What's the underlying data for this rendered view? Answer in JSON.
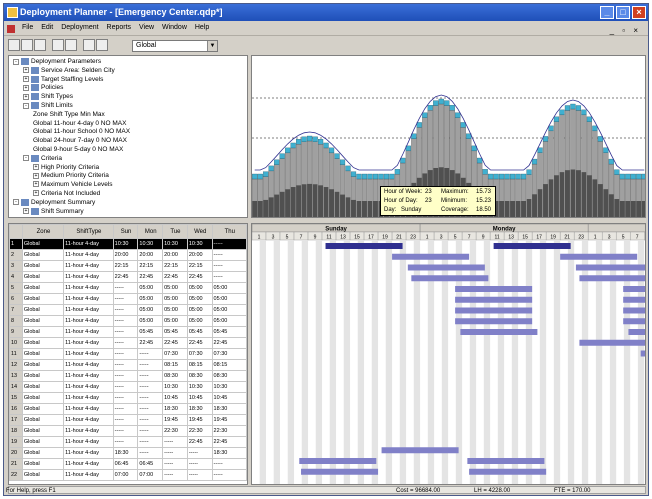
{
  "window": {
    "title": "Deployment Planner - [Emergency Center.qdp*]"
  },
  "menu": {
    "items": [
      "File",
      "Edit",
      "Deployment",
      "Reports",
      "View",
      "Window",
      "Help"
    ]
  },
  "toolbar": {
    "combo_value": "Global"
  },
  "tree": {
    "items": [
      {
        "label": "Deployment Parameters",
        "indent": 0,
        "box": "-"
      },
      {
        "label": "Service Area: Selden City",
        "indent": 1,
        "box": "+"
      },
      {
        "label": "Target Staffing Levels",
        "indent": 1,
        "box": "+"
      },
      {
        "label": "Policies",
        "indent": 1,
        "box": "+"
      },
      {
        "label": "Shift Types",
        "indent": 1,
        "box": "+"
      },
      {
        "label": "Shift Limits",
        "indent": 1,
        "box": "-"
      },
      {
        "label": "Zone  Shift Type       Min     Max",
        "indent": 2,
        "box": ""
      },
      {
        "label": "Global  11-hour 4-day   0        NO MAX",
        "indent": 2,
        "box": ""
      },
      {
        "label": "Global  11-hour School  0        NO MAX",
        "indent": 2,
        "box": ""
      },
      {
        "label": "Global  24-hour 7-day   0        NO MAX",
        "indent": 2,
        "box": ""
      },
      {
        "label": "Global  9-hour 5-day    0        NO MAX",
        "indent": 2,
        "box": ""
      },
      {
        "label": "Criteria",
        "indent": 1,
        "box": "-"
      },
      {
        "label": "High Priority Criteria",
        "indent": 2,
        "box": "+"
      },
      {
        "label": "Medium Priority Criteria",
        "indent": 2,
        "box": "+"
      },
      {
        "label": "Maximum Vehicle Levels",
        "indent": 2,
        "box": "+"
      },
      {
        "label": "Criteria Not Included",
        "indent": 2,
        "box": "+"
      },
      {
        "label": "Deployment Summary",
        "indent": 0,
        "box": "-"
      },
      {
        "label": "Shift Summary",
        "indent": 1,
        "box": "+"
      }
    ]
  },
  "tooltip": {
    "hour_of_week_label": "Hour of Week:",
    "hour_of_week": "23",
    "hour_of_day_label": "Hour of Day:",
    "hour_of_day": "23",
    "day_label": "Day:",
    "day": "Sunday",
    "maximum_label": "Maximum:",
    "maximum": "15.73",
    "minimum_label": "Minimum:",
    "minimum": "15.23",
    "coverage_label": "Coverage:",
    "coverage": "18.50"
  },
  "grid": {
    "columns": [
      "",
      "Zone",
      "ShiftType",
      "Sun",
      "Mon",
      "Tue",
      "Wed",
      "Thu"
    ],
    "rows": [
      [
        "1",
        "Global",
        "11-hour 4-day",
        "10:30",
        "10:30",
        "10:30",
        "10:30",
        "-----"
      ],
      [
        "2",
        "Global",
        "11-hour 4-day",
        "20:00",
        "20:00",
        "20:00",
        "20:00",
        "-----"
      ],
      [
        "3",
        "Global",
        "11-hour 4-day",
        "22:15",
        "22:15",
        "22:15",
        "22:15",
        "-----"
      ],
      [
        "4",
        "Global",
        "11-hour 4-day",
        "22:45",
        "22:45",
        "22:45",
        "22:45",
        "-----"
      ],
      [
        "5",
        "Global",
        "11-hour 4-day",
        "-----",
        "05:00",
        "05:00",
        "05:00",
        "05:00"
      ],
      [
        "6",
        "Global",
        "11-hour 4-day",
        "-----",
        "05:00",
        "05:00",
        "05:00",
        "05:00"
      ],
      [
        "7",
        "Global",
        "11-hour 4-day",
        "-----",
        "05:00",
        "05:00",
        "05:00",
        "05:00"
      ],
      [
        "8",
        "Global",
        "11-hour 4-day",
        "-----",
        "05:00",
        "05:00",
        "05:00",
        "05:00"
      ],
      [
        "9",
        "Global",
        "11-hour 4-day",
        "-----",
        "05:45",
        "05:45",
        "05:45",
        "05:45"
      ],
      [
        "10",
        "Global",
        "11-hour 4-day",
        "-----",
        "22:45",
        "22:45",
        "22:45",
        "22:45"
      ],
      [
        "11",
        "Global",
        "11-hour 4-day",
        "-----",
        "-----",
        "07:30",
        "07:30",
        "07:30"
      ],
      [
        "12",
        "Global",
        "11-hour 4-day",
        "-----",
        "-----",
        "08:15",
        "08:15",
        "08:15"
      ],
      [
        "13",
        "Global",
        "11-hour 4-day",
        "-----",
        "-----",
        "08:30",
        "08:30",
        "08:30"
      ],
      [
        "14",
        "Global",
        "11-hour 4-day",
        "-----",
        "-----",
        "10:30",
        "10:30",
        "10:30"
      ],
      [
        "15",
        "Global",
        "11-hour 4-day",
        "-----",
        "-----",
        "10:45",
        "10:45",
        "10:45"
      ],
      [
        "16",
        "Global",
        "11-hour 4-day",
        "-----",
        "-----",
        "18:30",
        "18:30",
        "18:30"
      ],
      [
        "17",
        "Global",
        "11-hour 4-day",
        "-----",
        "-----",
        "19:45",
        "19:45",
        "19:45"
      ],
      [
        "18",
        "Global",
        "11-hour 4-day",
        "-----",
        "-----",
        "22:30",
        "22:30",
        "22:30"
      ],
      [
        "19",
        "Global",
        "11-hour 4-day",
        "-----",
        "-----",
        "-----",
        "22:45",
        "22:45"
      ],
      [
        "20",
        "Global",
        "11-hour 4-day",
        "18:30",
        "-----",
        "-----",
        "-----",
        "18:30"
      ],
      [
        "21",
        "Global",
        "11-hour 4-day",
        "06:45",
        "06:45",
        "-----",
        "-----",
        "-----"
      ],
      [
        "22",
        "Global",
        "11-hour 4-day",
        "07:00",
        "07:00",
        "-----",
        "-----",
        "-----"
      ]
    ]
  },
  "gantt": {
    "days": [
      "Sunday",
      "Monday",
      "Tuesday"
    ],
    "hours": [
      "1",
      "3",
      "5",
      "7",
      "9",
      "11",
      "13",
      "15",
      "17",
      "19",
      "21",
      "23"
    ]
  },
  "status": {
    "help": "For Help, press F1",
    "cost": "Cost = 96684.00",
    "lh": "LH = 4228.00",
    "fte": "FTE = 170.00"
  },
  "colors": {
    "accent": "#0a246a",
    "bar": "#7a7aa8",
    "bar_dark": "#404040",
    "bar_light": "#a0a0a0",
    "coverage": "#40b0d0",
    "shift_bar": "#8080c8"
  }
}
